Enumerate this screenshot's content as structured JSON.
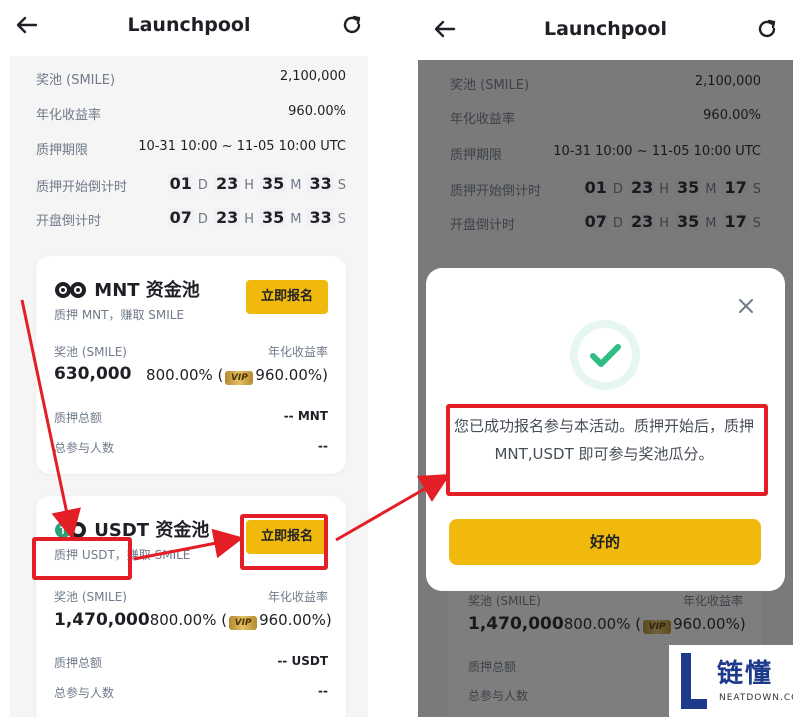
{
  "header": {
    "title": "Launchpool"
  },
  "info": {
    "prize_pool_label": "奖池 (SMILE)",
    "prize_pool_value": "2,100,000",
    "apr_label": "年化收益率",
    "apr_value": "960.00%",
    "period_label": "质押期限",
    "period_value": "10-31 10:00 ~ 11-05 10:00 UTC",
    "stake_countdown_label": "质押开始倒计时",
    "open_countdown_label": "开盘倒计时",
    "units": {
      "d": "D",
      "h": "H",
      "m": "M",
      "s": "S"
    }
  },
  "left": {
    "stake_countdown": {
      "d": "01",
      "h": "23",
      "m": "35",
      "s": "33"
    },
    "open_countdown": {
      "d": "07",
      "h": "23",
      "m": "35",
      "s": "33"
    }
  },
  "right": {
    "stake_countdown": {
      "d": "01",
      "h": "23",
      "m": "35",
      "s": "17"
    },
    "open_countdown": {
      "d": "07",
      "h": "23",
      "m": "35",
      "s": "17"
    }
  },
  "pools": [
    {
      "title": "MNT 资金池",
      "subtitle": "质押 MNT，赚取 SMILE",
      "join_label": "立即报名",
      "prize_label": "奖池 (SMILE)",
      "apr_label": "年化收益率",
      "prize_value": "630,000",
      "apr_value": "800.00% (",
      "vip_label": "VIP",
      "vip_apr": "960.00%)",
      "total_label": "质押总额",
      "total_value": "-- MNT",
      "participants_label": "总参与人数",
      "participants_value": "--"
    },
    {
      "title": "USDT 资金池",
      "subtitle": "质押 USDT，赚取 SMILE",
      "join_label": "立即报名",
      "prize_label": "奖池 (SMILE)",
      "apr_label": "年化收益率",
      "prize_value": "1,470,000",
      "apr_value": "800.00% (",
      "vip_label": "VIP",
      "vip_apr": "960.00%)",
      "total_label": "质押总额",
      "total_value": "-- USDT",
      "participants_label": "总参与人数",
      "participants_value": "--"
    }
  ],
  "dialog": {
    "message": "您已成功报名参与本活动。质押开始后，质押 MNT,USDT 即可参与奖池瓜分。",
    "ok_label": "好的"
  },
  "watermark": {
    "cn": "链懂",
    "en": "NEATDOWN.COM"
  },
  "colors": {
    "accent": "#f0b90b",
    "highlight": "#e41e26",
    "success": "#2ebd85"
  }
}
